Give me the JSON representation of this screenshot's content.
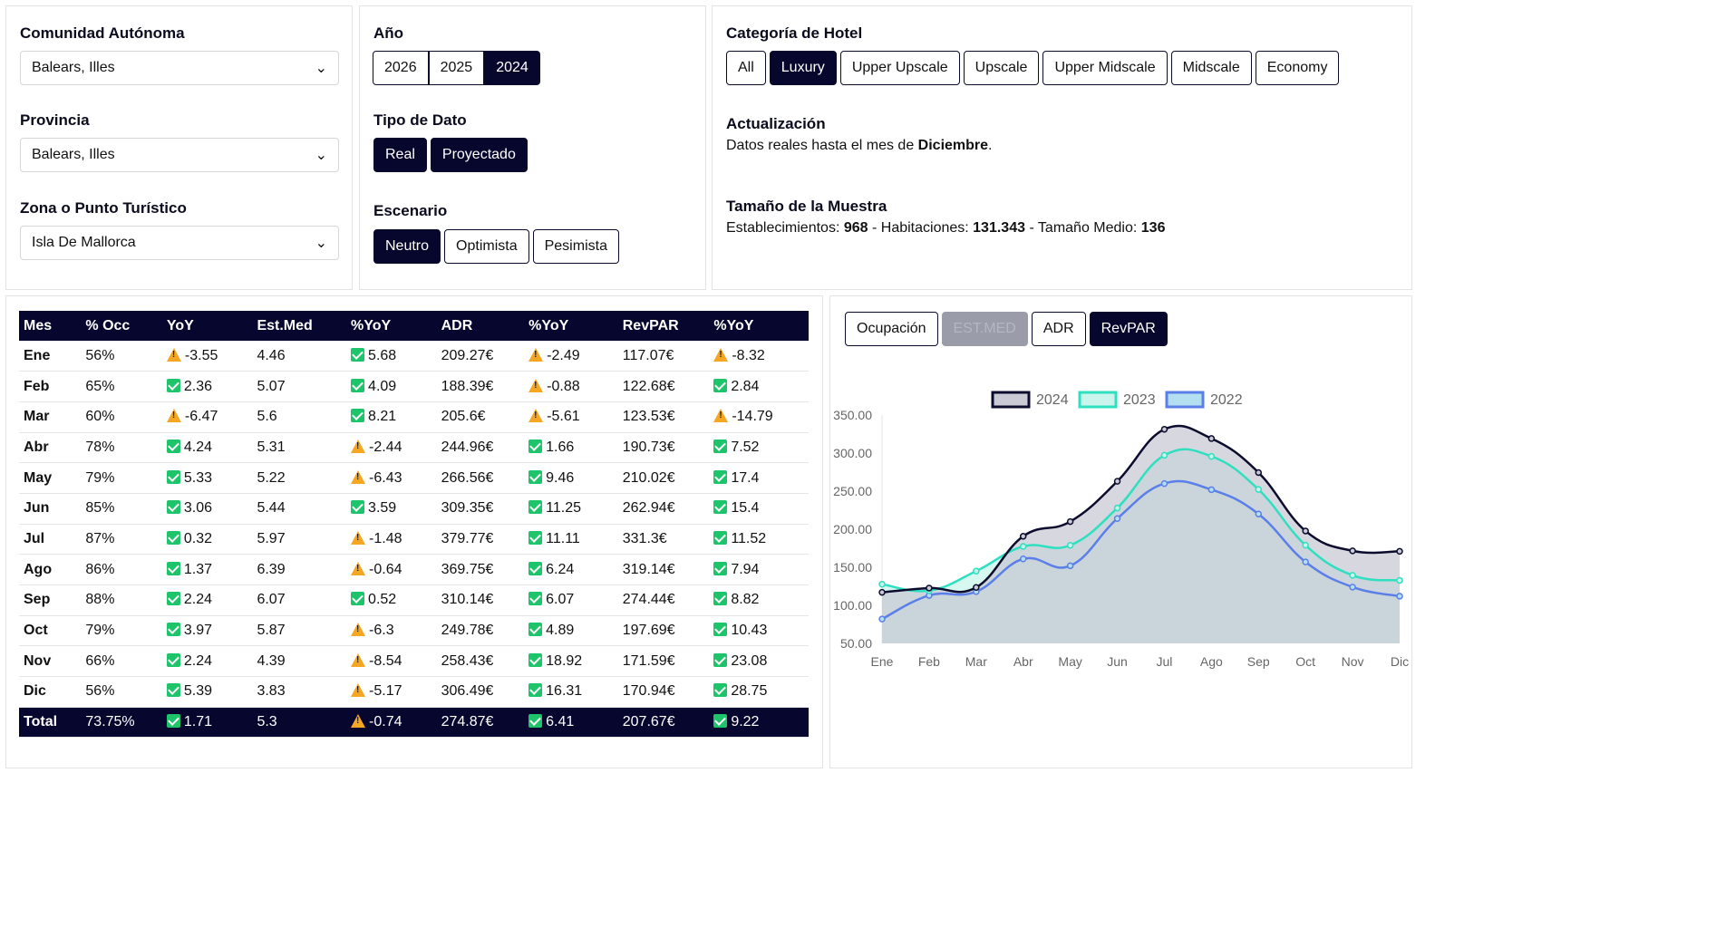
{
  "filters": {
    "comunidad": {
      "label": "Comunidad Autónoma",
      "value": "Balears, Illes"
    },
    "provincia": {
      "label": "Provincia",
      "value": "Balears, Illes"
    },
    "zona": {
      "label": "Zona o Punto Turístico",
      "value": "Isla De Mallorca"
    },
    "anio": {
      "label": "Año",
      "options": [
        "2026",
        "2025",
        "2024"
      ],
      "selected": "2024"
    },
    "tipo": {
      "label": "Tipo de Dato",
      "options": [
        "Real",
        "Proyectado"
      ]
    },
    "escenario": {
      "label": "Escenario",
      "options": [
        "Neutro",
        "Optimista",
        "Pesimista"
      ],
      "selected": "Neutro"
    },
    "categoria": {
      "label": "Categoría de Hotel",
      "options": [
        "All",
        "Luxury",
        "Upper Upscale",
        "Upscale",
        "Upper Midscale",
        "Midscale",
        "Economy"
      ],
      "selected": "Luxury"
    }
  },
  "info": {
    "actualizacion_title": "Actualización",
    "actualizacion_pre": "Datos reales hasta el mes de ",
    "actualizacion_mes": "Diciembre",
    "actualizacion_post": ".",
    "muestra_title": "Tamaño de la Muestra",
    "est_label": "Establecimientos: ",
    "est": "968",
    "hab_label": " - Habitaciones: ",
    "hab": "131.343",
    "tm_label": " - Tamaño Medio: ",
    "tm": "136"
  },
  "table": {
    "headers": [
      "Mes",
      "% Occ",
      "YoY",
      "Est.Med",
      "%YoY",
      "ADR",
      "%YoY",
      "RevPAR",
      "%YoY"
    ],
    "rows": [
      [
        "Ene",
        "56%",
        "-3.55",
        "4.46",
        "5.68",
        "209.27€",
        "-2.49",
        "117.07€",
        "-8.32"
      ],
      [
        "Feb",
        "65%",
        "2.36",
        "5.07",
        "4.09",
        "188.39€",
        "-0.88",
        "122.68€",
        "2.84"
      ],
      [
        "Mar",
        "60%",
        "-6.47",
        "5.6",
        "8.21",
        "205.6€",
        "-5.61",
        "123.53€",
        "-14.79"
      ],
      [
        "Abr",
        "78%",
        "4.24",
        "5.31",
        "-2.44",
        "244.96€",
        "1.66",
        "190.73€",
        "7.52"
      ],
      [
        "May",
        "79%",
        "5.33",
        "5.22",
        "-6.43",
        "266.56€",
        "9.46",
        "210.02€",
        "17.4"
      ],
      [
        "Jun",
        "85%",
        "3.06",
        "5.44",
        "3.59",
        "309.35€",
        "11.25",
        "262.94€",
        "15.4"
      ],
      [
        "Jul",
        "87%",
        "0.32",
        "5.97",
        "-1.48",
        "379.77€",
        "11.11",
        "331.3€",
        "11.52"
      ],
      [
        "Ago",
        "86%",
        "1.37",
        "6.39",
        "-0.64",
        "369.75€",
        "6.24",
        "319.14€",
        "7.94"
      ],
      [
        "Sep",
        "88%",
        "2.24",
        "6.07",
        "0.52",
        "310.14€",
        "6.07",
        "274.44€",
        "8.82"
      ],
      [
        "Oct",
        "79%",
        "3.97",
        "5.87",
        "-6.3",
        "249.78€",
        "4.89",
        "197.69€",
        "10.43"
      ],
      [
        "Nov",
        "66%",
        "2.24",
        "4.39",
        "-8.54",
        "258.43€",
        "18.92",
        "171.59€",
        "23.08"
      ],
      [
        "Dic",
        "56%",
        "5.39",
        "3.83",
        "-5.17",
        "306.49€",
        "16.31",
        "170.94€",
        "28.75"
      ]
    ],
    "total": [
      "Total",
      "73.75%",
      "1.71",
      "5.3",
      "-0.74",
      "274.87€",
      "6.41",
      "207.67€",
      "9.22"
    ]
  },
  "chart_tabs": {
    "options": [
      "Ocupación",
      "EST.MED",
      "ADR",
      "RevPAR"
    ],
    "selected": "RevPAR",
    "disabled": "EST.MED"
  },
  "chart_data": {
    "type": "area",
    "categories": [
      "Ene",
      "Feb",
      "Mar",
      "Abr",
      "May",
      "Jun",
      "Jul",
      "Ago",
      "Sep",
      "Oct",
      "Nov",
      "Dic"
    ],
    "ylim": [
      50,
      350
    ],
    "yticks": [
      "350.00",
      "300.00",
      "250.00",
      "200.00",
      "150.00",
      "100.00",
      "50.00"
    ],
    "legend": "top",
    "series": [
      {
        "name": "2024",
        "color": "#0c0c2e",
        "fill": "#c9cad4",
        "values": [
          117.07,
          122.68,
          123.53,
          190.73,
          210.02,
          262.94,
          331.3,
          319.14,
          274.44,
          197.69,
          171.59,
          170.94
        ]
      },
      {
        "name": "2023",
        "color": "#2ee0c0",
        "fill": "#c9f5ec",
        "values": [
          127.7,
          119.3,
          145.0,
          177.4,
          178.9,
          227.9,
          297.1,
          295.7,
          252.2,
          179.0,
          139.4,
          132.8
        ]
      },
      {
        "name": "2022",
        "color": "#5a7fe8",
        "fill": "#b3dff0",
        "values": [
          82,
          113,
          118,
          161,
          152,
          214,
          260,
          252,
          220,
          157,
          124,
          112
        ]
      }
    ]
  }
}
